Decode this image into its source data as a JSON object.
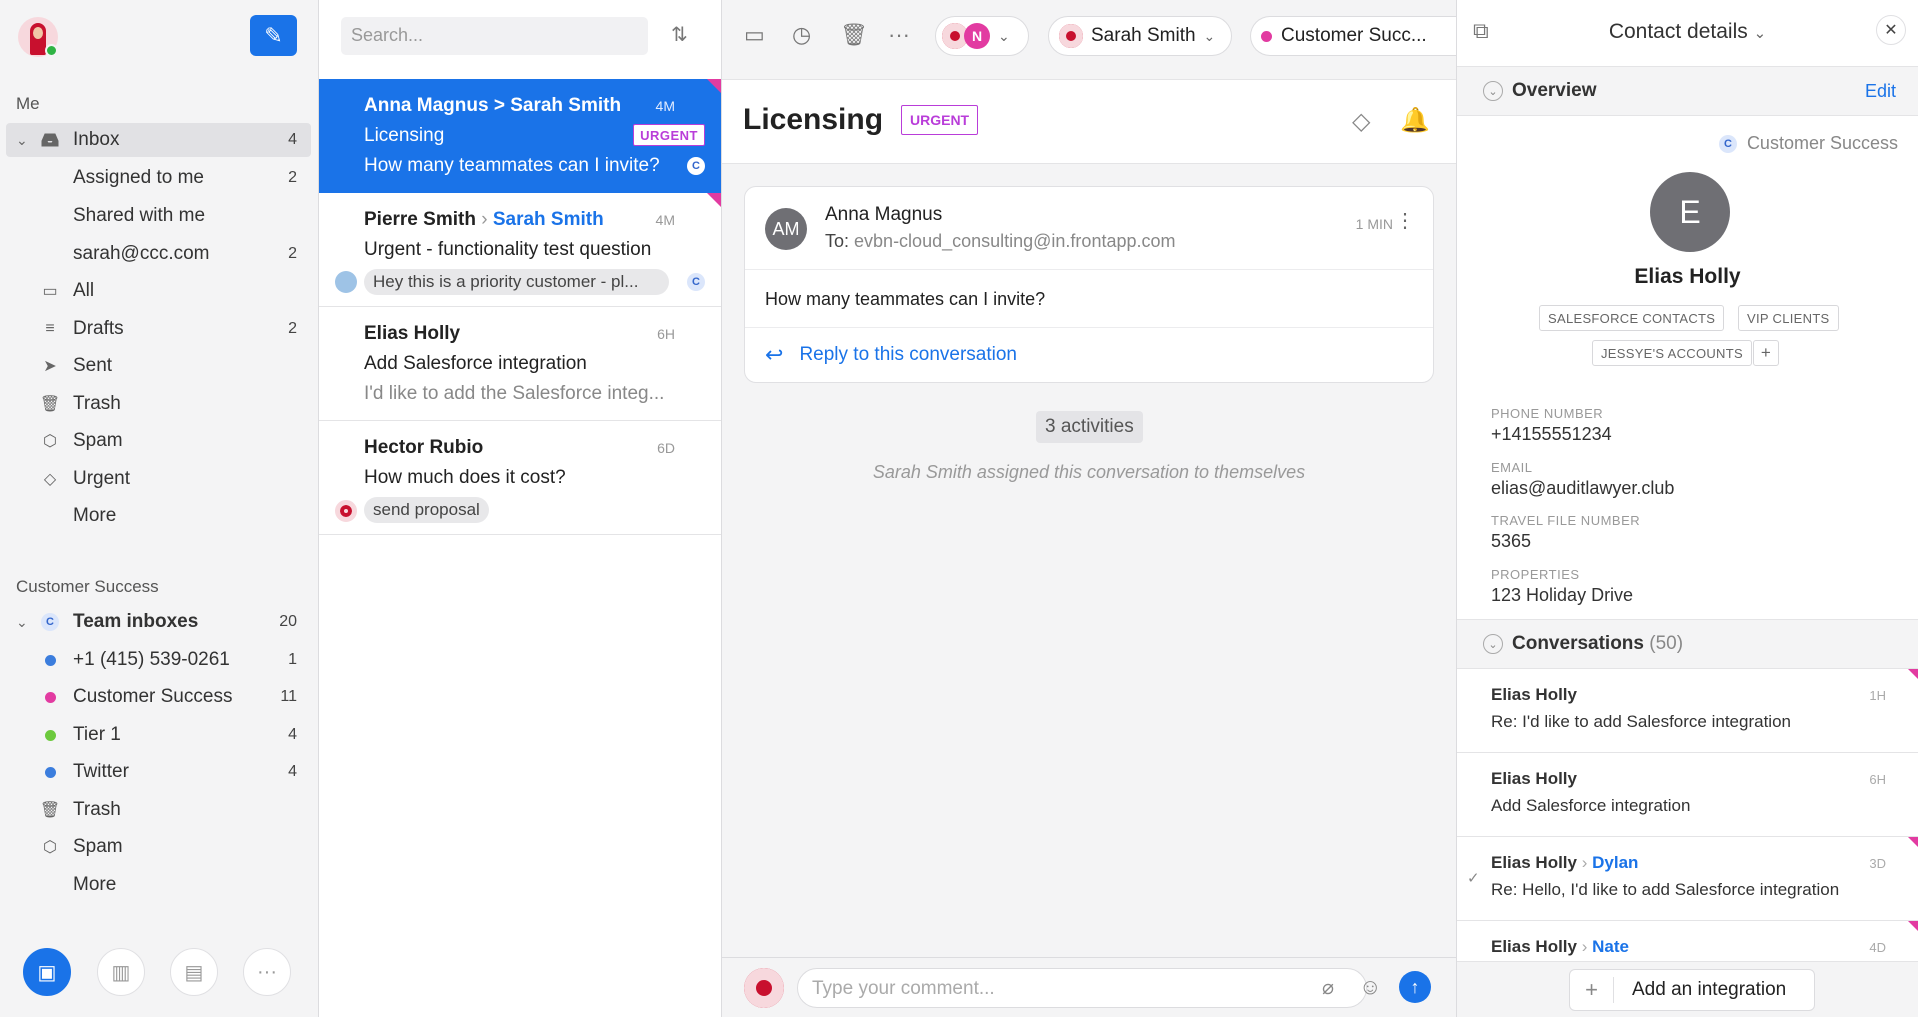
{
  "sidebar": {
    "me_header": "Me",
    "items": [
      {
        "label": "Inbox",
        "count": "4",
        "icon": "inbox-icon"
      },
      {
        "label": "Assigned to me",
        "count": "2"
      },
      {
        "label": "Shared with me",
        "count": ""
      },
      {
        "label": "sarah@ccc.com",
        "count": "2"
      },
      {
        "label": "All",
        "count": "",
        "icon": "archive-icon"
      },
      {
        "label": "Drafts",
        "count": "2",
        "icon": "drafts-icon"
      },
      {
        "label": "Sent",
        "count": "",
        "icon": "send-icon"
      },
      {
        "label": "Trash",
        "count": "",
        "icon": "trash-icon"
      },
      {
        "label": "Spam",
        "count": "",
        "icon": "spam-icon"
      },
      {
        "label": "Urgent",
        "count": "",
        "icon": "tag-icon"
      },
      {
        "label": "More",
        "count": ""
      }
    ],
    "team_header": "Customer Success",
    "team_items": [
      {
        "label": "Team inboxes",
        "count": "20",
        "badge": "C"
      },
      {
        "label": "+1 (415) 539-0261",
        "count": "1",
        "color": "#3b7ddd"
      },
      {
        "label": "Customer Success",
        "count": "11",
        "color": "#e23ba1"
      },
      {
        "label": "Tier 1",
        "count": "4",
        "color": "#6cc93d"
      },
      {
        "label": "Twitter",
        "count": "4",
        "color": "#3b7ddd"
      },
      {
        "label": "Trash",
        "count": "",
        "icon": "trash-icon"
      },
      {
        "label": "Spam",
        "count": "",
        "icon": "spam-icon"
      },
      {
        "label": "More",
        "count": ""
      }
    ]
  },
  "list": {
    "search_placeholder": "Search...",
    "conversations": [
      {
        "from": "Anna Magnus",
        "to": "Sarah Smith",
        "time": "4M",
        "subject": "Licensing",
        "preview": "How many teammates can I invite?",
        "tag": "URGENT",
        "badge": "C"
      },
      {
        "from": "Pierre Smith",
        "to": "Sarah Smith",
        "time": "4M",
        "subject": "Urgent - functionality test question",
        "preview": "Hey this is a priority customer - pl...",
        "badge": "C"
      },
      {
        "from": "Elias Holly",
        "time": "6H",
        "subject": "Add Salesforce integration",
        "preview": "I'd like to add the Salesforce integ..."
      },
      {
        "from": "Hector Rubio",
        "time": "6D",
        "subject": "How much does it cost?",
        "preview": "send proposal"
      }
    ]
  },
  "main": {
    "toolbar": {
      "assignee_initial": "N",
      "assignee_name": "Sarah Smith",
      "inbox_name": "Customer Succ..."
    },
    "subject": "Licensing",
    "tag": "URGENT",
    "message": {
      "avatar": "AM",
      "sender": "Anna Magnus",
      "to_prefix": "To:",
      "to": "evbn-cloud_consulting@in.frontapp.com",
      "time": "1 MIN",
      "body": "How many teammates can I invite?",
      "reply_label": "Reply to this conversation"
    },
    "activities": "3 activities",
    "assigned_note": "Sarah Smith assigned this conversation to themselves",
    "comment_placeholder": "Type your comment..."
  },
  "details": {
    "title": "Contact details",
    "overview_label": "Overview",
    "edit_label": "Edit",
    "team_badge": "C",
    "team_name": "Customer Success",
    "avatar_letter": "E",
    "name": "Elias Holly",
    "tags": [
      "SALESFORCE CONTACTS",
      "VIP CLIENTS",
      "JESSYE'S ACCOUNTS"
    ],
    "fields": [
      {
        "label": "PHONE NUMBER",
        "value": "+14155551234"
      },
      {
        "label": "EMAIL",
        "value": "elias@auditlawyer.club"
      },
      {
        "label": "TRAVEL FILE NUMBER",
        "value": "5365"
      },
      {
        "label": "PROPERTIES",
        "value": "123 Holiday Drive"
      }
    ],
    "conversations_label": "Conversations",
    "conversations_count": "(50)",
    "conversations": [
      {
        "name": "Elias Holly",
        "to": "",
        "time": "1H",
        "subject": "Re: I'd like to add Salesforce integration"
      },
      {
        "name": "Elias Holly",
        "to": "",
        "time": "6H",
        "subject": "Add Salesforce integration"
      },
      {
        "name": "Elias Holly",
        "to": "Dylan",
        "time": "3D",
        "subject": "Re: Hello, I'd like to add Salesforce integration"
      },
      {
        "name": "Elias Holly",
        "to": "Nate",
        "time": "4D",
        "subject": ""
      }
    ],
    "add_integration": "Add an integration"
  }
}
